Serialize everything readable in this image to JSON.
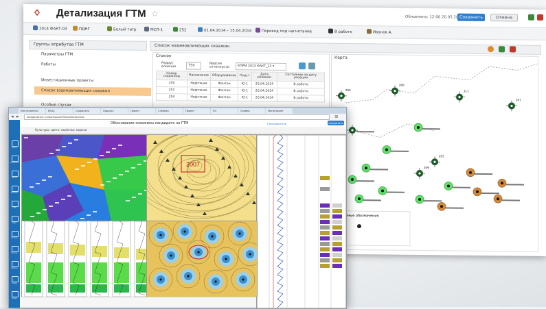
{
  "back_window": {
    "title": "Детализация ГТМ",
    "updated": "Обновлено: 12:00 20.05.2014",
    "save_label": "Сохранить",
    "cancel_label": "Отмена",
    "toolbar": [
      {
        "label": "2014 ФАКТ-03",
        "color": "#4a6ea8"
      },
      {
        "label": "ПДНГ",
        "color": "#c08a2e"
      },
      {
        "label": "Белый тигр",
        "color": "#6a8a2a"
      },
      {
        "label": "МСП-1",
        "color": "#5a6a7a"
      },
      {
        "label": "252",
        "color": "#3b8a3b"
      },
      {
        "label": "01.04.2014 – 15.04.2014",
        "color": "#3a7fc1"
      },
      {
        "label": "Перевод под нагнетание",
        "color": "#7a4a9a"
      },
      {
        "label": "В работе",
        "color": "#333333"
      },
      {
        "label": "Иванов А.",
        "color": "#8a6a3a"
      }
    ],
    "sidebar": {
      "header": "Группы атрибутов ГТМ",
      "items": [
        "Параметры ГТМ",
        "Работы",
        "Инвестиционные проекты",
        "Список взаимовлияющих скважин",
        "Особые случаи"
      ],
      "selected_index": 3
    },
    "main_header": "Список взаимовлияющих скважин",
    "list": {
      "title": "Список",
      "radius_label": "Радиус влияния",
      "radius_value": "750",
      "version_label": "Версия отчетности",
      "version_value": "КПРМ 2013 ФАКТ_12",
      "columns": [
        "Номер скважины",
        "Назначение",
        "Оборудование",
        "Пласт",
        "Дата резации",
        "Состояние на дату резации"
      ],
      "rows": [
        [
          "250",
          "Нефтяная",
          "Фонтан",
          "Ю-1",
          "20.04.2014",
          "В работе"
        ],
        [
          "251",
          "Нефтяная",
          "Фонтан",
          "Ю-1",
          "20.04.2014",
          "В работе"
        ],
        [
          "254",
          "Нефтяная",
          "Фонтан",
          "Ю-1",
          "20.04.2014",
          "В работе"
        ]
      ]
    },
    "map": {
      "title": "Карта",
      "legend_title": "Условные обозначения",
      "wells": [
        {
          "label": "206",
          "kind": "cross"
        },
        {
          "label": "200",
          "kind": "cross"
        },
        {
          "label": "211",
          "kind": "cross"
        },
        {
          "label": "207",
          "kind": "cross"
        },
        {
          "label": "205",
          "kind": "cross"
        },
        {
          "label": "209",
          "kind": "cross"
        },
        {
          "label": "",
          "kind": "green"
        },
        {
          "label": "",
          "kind": "green"
        },
        {
          "label": "",
          "kind": "green"
        },
        {
          "label": "",
          "kind": "green"
        },
        {
          "label": "",
          "kind": "brown"
        },
        {
          "label": "",
          "kind": "brown"
        },
        {
          "label": "",
          "kind": "brown"
        },
        {
          "label": "",
          "kind": "green"
        },
        {
          "label": "",
          "kind": "brown"
        },
        {
          "label": "",
          "kind": "green"
        },
        {
          "label": "",
          "kind": "green"
        },
        {
          "label": "",
          "kind": "brown"
        },
        {
          "label": "",
          "kind": "green"
        },
        {
          "label": "",
          "kind": "cross"
        }
      ]
    }
  },
  "front_window": {
    "tabs": [
      "Инструменты",
      "ЕКАС",
      "Сохранить",
      "Процесс",
      "Проект",
      "Главная",
      "Проект",
      "КЗ",
      "Сервер",
      "Мониторинг"
    ],
    "address": "webgazprom.ru/workspace/fields/wells/view",
    "app_title": "Обоснование скважины кандидата на ГТМ",
    "app_right": "Пользователь",
    "app_button": "Сохранить",
    "subhead": "Культуры: цвета: свойства: модели",
    "map_label": "2007",
    "sidebar_labels": [
      "Поиск",
      "Скважины",
      "Карты",
      "Разрезы",
      "ГИС",
      "Керн",
      "Отчеты",
      "Пласты",
      "Работы",
      "Схемы",
      "Архив"
    ]
  }
}
